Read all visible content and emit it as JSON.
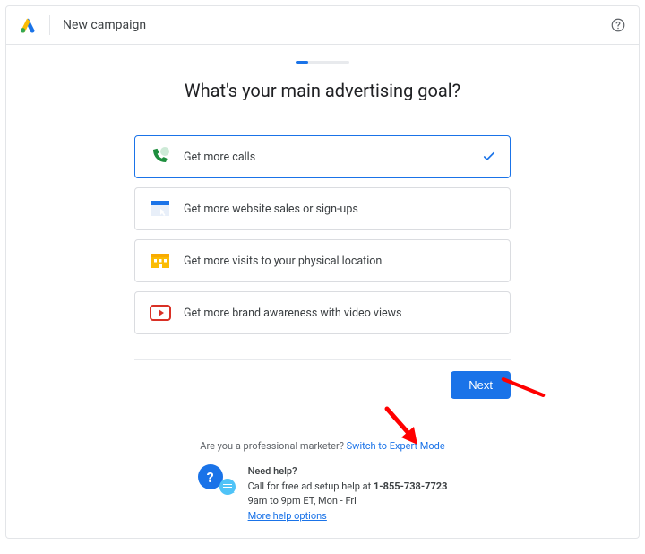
{
  "header": {
    "title": "New campaign"
  },
  "question": "What's your main advertising goal?",
  "options": [
    {
      "label": "Get more calls",
      "selected": true
    },
    {
      "label": "Get more website sales or sign-ups",
      "selected": false
    },
    {
      "label": "Get more visits to your physical location",
      "selected": false
    },
    {
      "label": "Get more brand awareness with video views",
      "selected": false
    }
  ],
  "next_label": "Next",
  "expert": {
    "prompt": "Are you a professional marketer? ",
    "link": "Switch to Expert Mode"
  },
  "help": {
    "heading": "Need help?",
    "line1_prefix": "Call for free ad setup help at ",
    "phone": "1-855-738-7723",
    "hours": "9am to 9pm ET, Mon - Fri",
    "more": "More help options"
  }
}
